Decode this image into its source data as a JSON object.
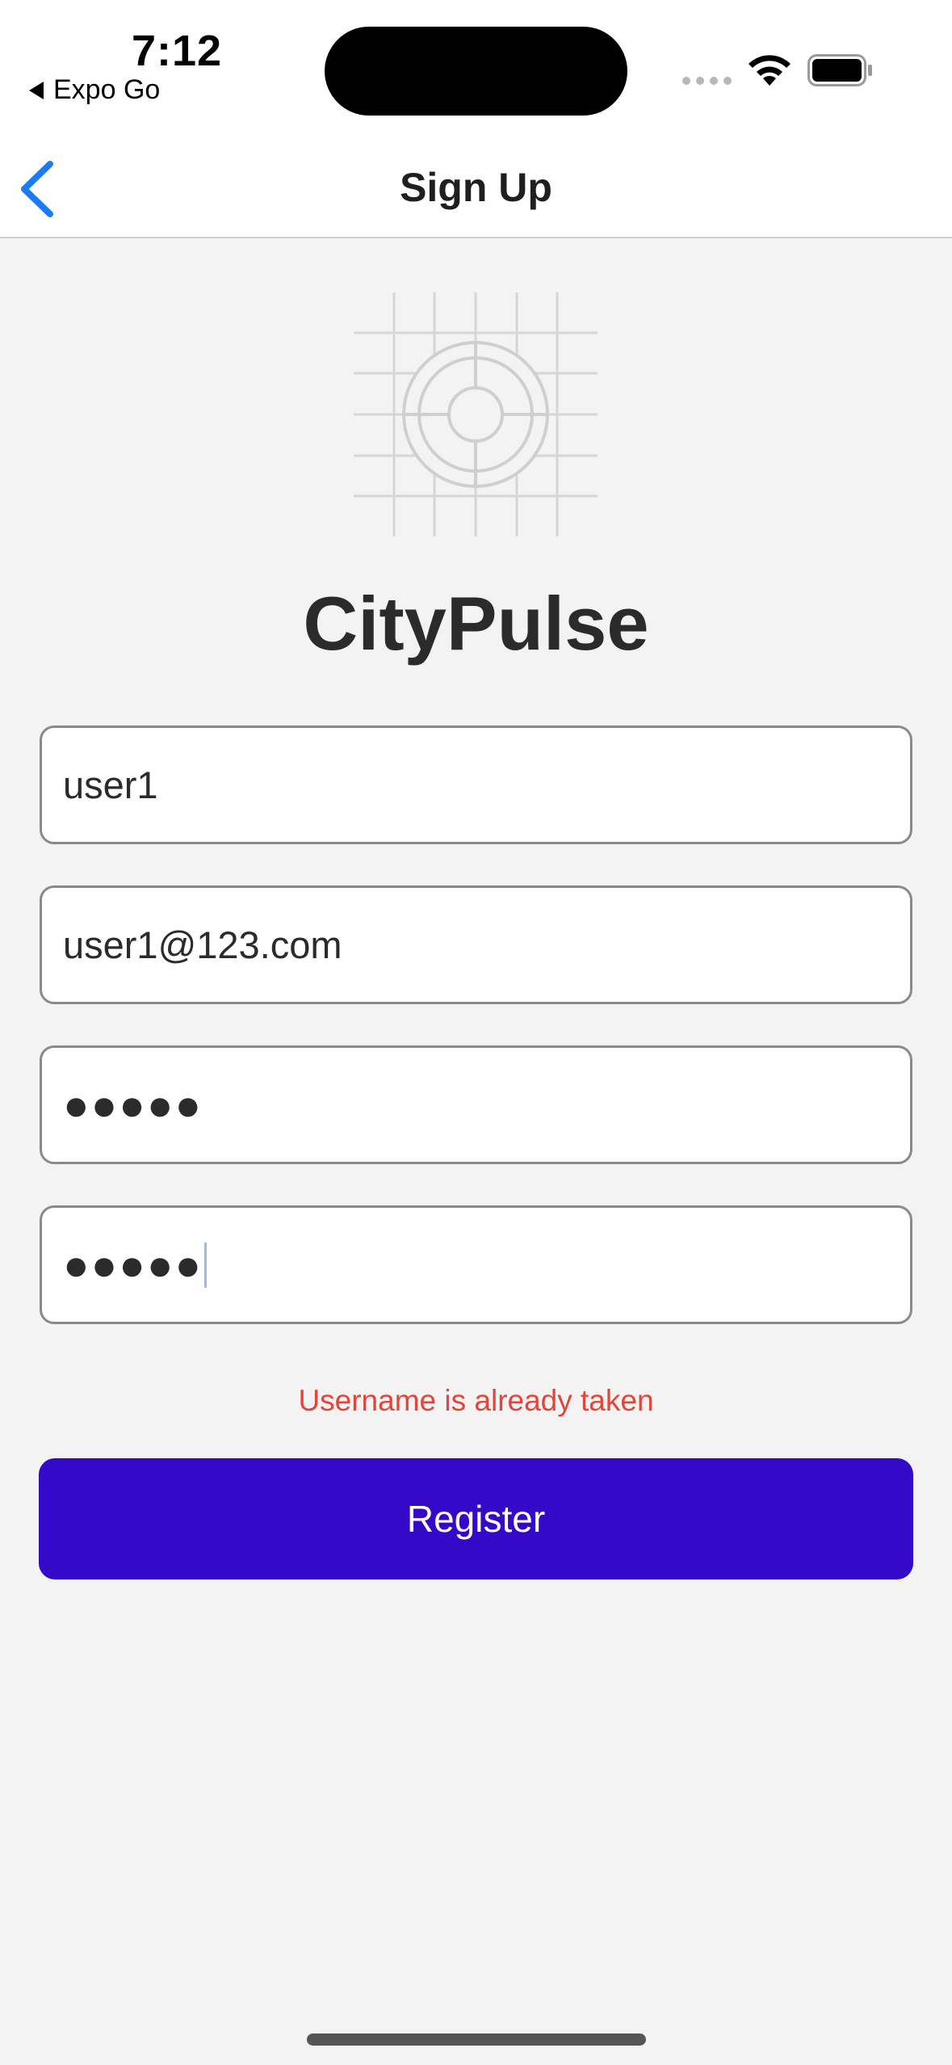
{
  "status_bar": {
    "time": "7:12",
    "back_app_label": "Expo Go"
  },
  "nav": {
    "title": "Sign Up"
  },
  "app": {
    "name": "CityPulse"
  },
  "form": {
    "username_value": "user1",
    "email_value": "user1@123.com",
    "password_value": "●●●●●",
    "confirm_password_value": "●●●●●",
    "error_message": "Username is already taken",
    "register_label": "Register"
  },
  "colors": {
    "accent_blue": "#1a7cf5",
    "register_button": "#3409c8",
    "error_text": "#e2463b",
    "background": "#f3f3f3"
  },
  "icons": {
    "nav_back": "chevron-left-icon",
    "logo": "target-grid-icon",
    "wifi": "wifi-icon",
    "battery": "battery-icon"
  }
}
